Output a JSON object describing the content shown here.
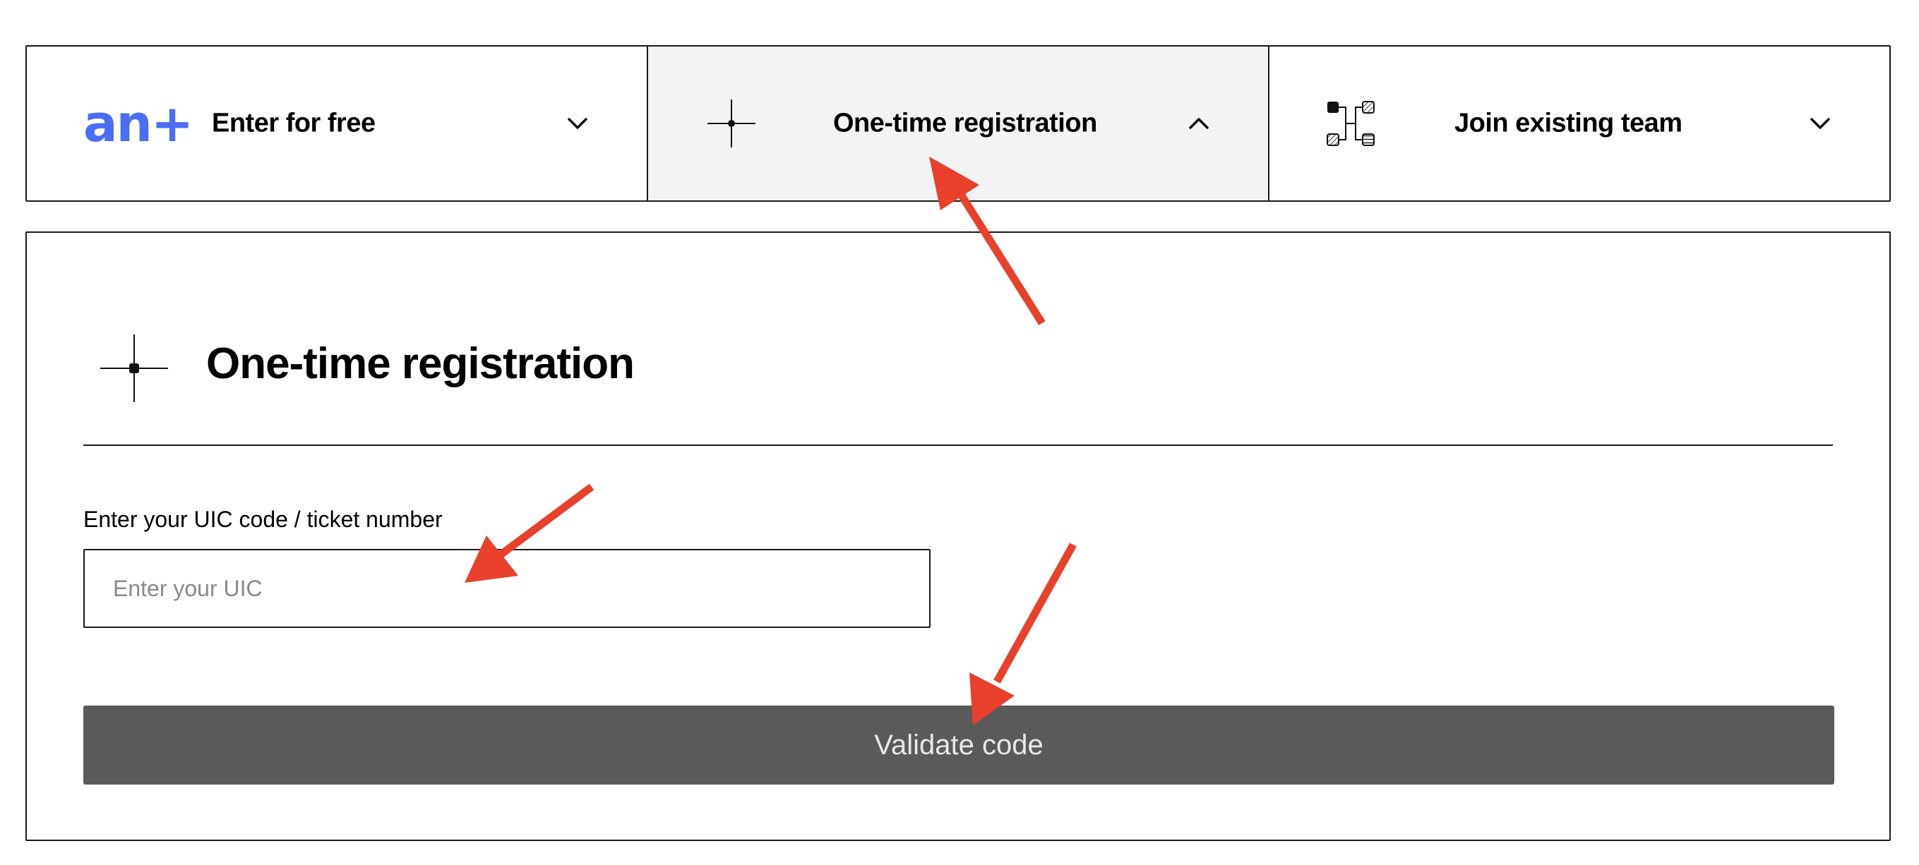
{
  "tabs": [
    {
      "brand": "an+",
      "label": "Enter for free",
      "icon": "brand-logo",
      "chevron": "chevron-down-icon",
      "active": false
    },
    {
      "label": "One-time registration",
      "icon": "crosshair-icon",
      "chevron": "chevron-up-icon",
      "active": true
    },
    {
      "label": "Join existing team",
      "icon": "team-network-icon",
      "chevron": "chevron-down-icon",
      "active": false
    }
  ],
  "panel": {
    "icon": "crosshair-icon",
    "title": "One-time registration",
    "field_label": "Enter your UIC code / ticket number",
    "input": {
      "value": "",
      "placeholder": "Enter your UIC"
    },
    "button_label": "Validate code"
  },
  "colors": {
    "brand": "#4a6cf7",
    "border": "#1a1a1a",
    "active_tab_bg": "#f3f3f3",
    "button_bg": "#5a5a5a",
    "button_text": "#e9e9e9",
    "annotation_arrow": "#e8402b"
  },
  "annotations": {
    "arrow_count": 3,
    "arrow_color": "#e8402b"
  }
}
